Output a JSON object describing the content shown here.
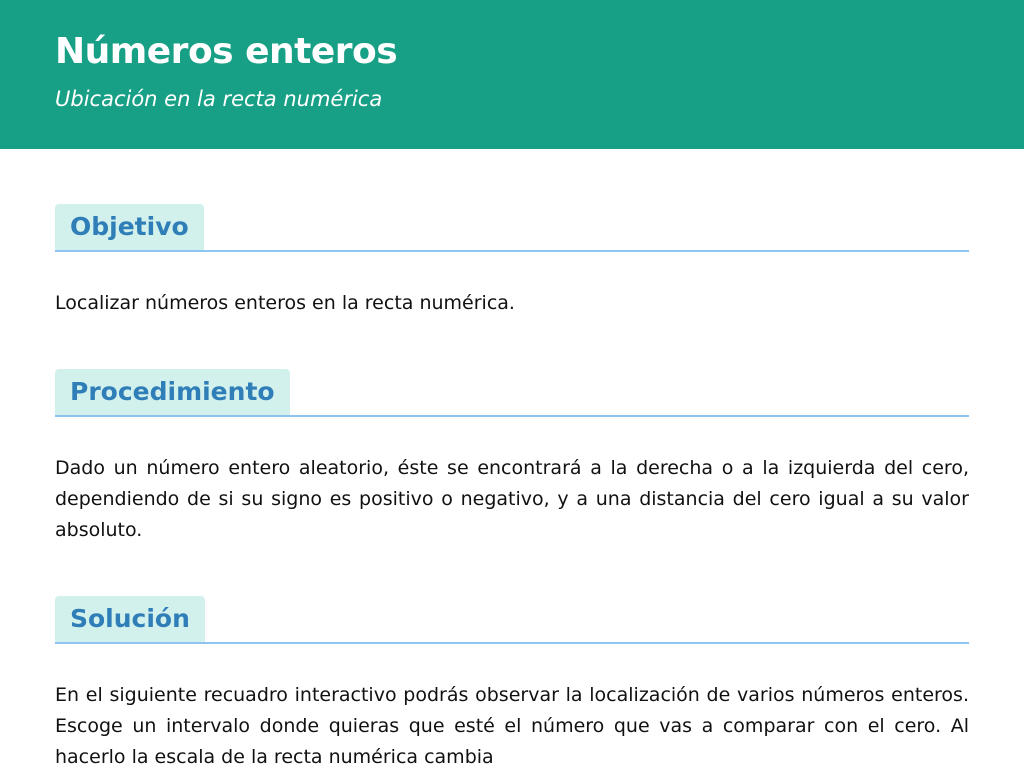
{
  "header": {
    "title": "Números enteros",
    "subtitle": "Ubicación en la recta numérica"
  },
  "sections": [
    {
      "heading": "Objetivo",
      "body": "Localizar números enteros en la recta numérica."
    },
    {
      "heading": "Procedimiento",
      "body": "Dado un número entero aleatorio, éste se encontrará a la derecha o a la izquierda del cero, dependiendo de si su signo es positivo o negativo, y a una distancia del cero igual a su valor absoluto."
    },
    {
      "heading": "Solución",
      "body": "En el siguiente recuadro interactivo podrás observar la localización de varios números enteros. Escoge un intervalo donde quieras que esté el número que vas a comparar con el cero. Al hacerlo la escala de la recta numérica cambia"
    }
  ],
  "colors": {
    "header_bg": "#17a085",
    "heading_bg": "#d3f1ec",
    "heading_text": "#2f7eb8",
    "rule": "#8ec5f0"
  }
}
